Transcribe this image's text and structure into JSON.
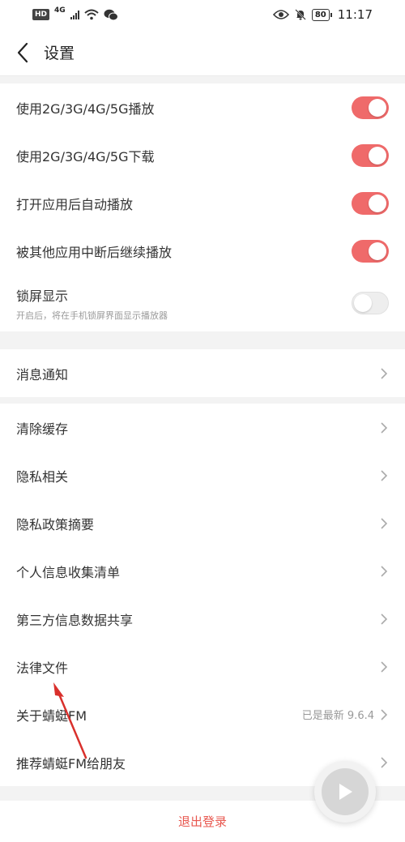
{
  "status_bar": {
    "left_badge": "HD",
    "network": "4G",
    "time": "11:17",
    "battery": "80",
    "icons": [
      "hd-icon",
      "signal-icon",
      "wifi-icon",
      "wechat-icon",
      "eye-icon",
      "mute-bell-icon",
      "battery-icon"
    ]
  },
  "header": {
    "title": "设置",
    "back_icon": "back-arrow-icon"
  },
  "playback_group": {
    "items": [
      {
        "label": "使用2G/3G/4G/5G播放",
        "toggle": "on"
      },
      {
        "label": "使用2G/3G/4G/5G下载",
        "toggle": "on"
      },
      {
        "label": "打开应用后自动播放",
        "toggle": "on"
      },
      {
        "label": "被其他应用中断后继续播放",
        "toggle": "on"
      },
      {
        "label": "锁屏显示",
        "sublabel": "开启后，将在手机锁屏界面显示播放器",
        "toggle": "off"
      }
    ]
  },
  "notify_group": {
    "items": [
      {
        "label": "消息通知"
      }
    ]
  },
  "misc_group": {
    "items": [
      {
        "label": "清除缓存"
      },
      {
        "label": "隐私相关"
      },
      {
        "label": "隐私政策摘要"
      },
      {
        "label": "个人信息收集清单"
      },
      {
        "label": "第三方信息数据共享"
      },
      {
        "label": "法律文件"
      },
      {
        "label": "关于蜻蜓FM",
        "value": "已是最新 9.6.4"
      },
      {
        "label": "推荐蜻蜓FM给朋友"
      }
    ]
  },
  "logout": {
    "label": "退出登录"
  },
  "colors": {
    "accent": "#ef6a6a",
    "logout_text": "#e8574f",
    "annotation_arrow": "#d9302c"
  }
}
